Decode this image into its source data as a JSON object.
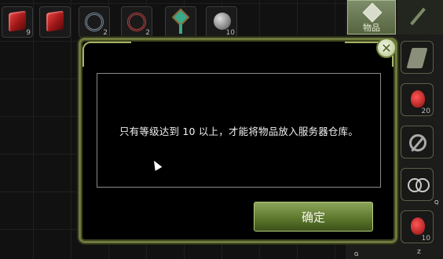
{
  "dialog": {
    "message": "只有等级达到 10 以上，才能将物品放入服务器仓库。",
    "confirm_label": "确定",
    "close_icon": "close-icon"
  },
  "inventory_top": [
    {
      "icon": "red-gem-icon",
      "count": "9"
    },
    {
      "icon": "red-gem-icon",
      "count": ""
    },
    {
      "icon": "blue-swirl-icon",
      "count": "2"
    },
    {
      "icon": "red-swirl-icon",
      "count": "2"
    },
    {
      "icon": "amulet-icon",
      "count": ""
    },
    {
      "icon": "orb-icon",
      "count": "10"
    }
  ],
  "right_panel": {
    "tab_label": "物品",
    "slots": [
      {
        "icon": "axe-icon",
        "count": ""
      },
      {
        "icon": "red-potion-icon",
        "count": "20"
      },
      {
        "icon": "no-entry-icon",
        "count": ""
      },
      {
        "icon": "rings-icon",
        "count": ""
      },
      {
        "icon": "red-potion-icon",
        "count": "10"
      }
    ],
    "hotkeys": [
      "G",
      "Q",
      "Z"
    ]
  },
  "colors": {
    "frame_green": "#6e7a3e",
    "button_green": "#7a954a",
    "text_white": "#f0f0f0"
  }
}
